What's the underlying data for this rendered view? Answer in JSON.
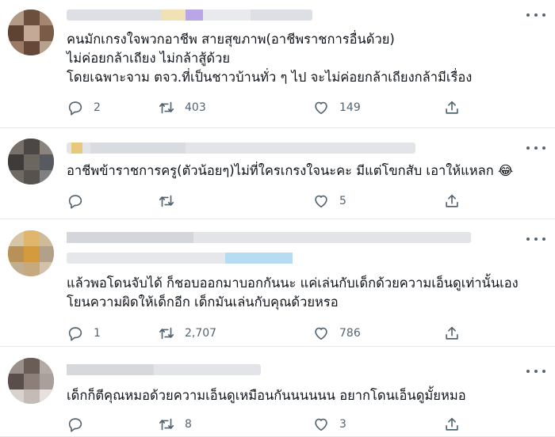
{
  "tweets": [
    {
      "lines": [
        "คนมักเกรงใจพวกอาชีพ สายสุขภาพ(อาชีพราชการอื่นด้วย)",
        "ไม่ค่อยกล้าเถียง ไม่กล้าสู้ด้วย",
        "โดยเฉพาะจาม ตจว.ที่เป็นชาวบ้านทั่ว ๆ ไป จะไม่ค่อยกล้าเถียงกล้ามีเรื่อง"
      ],
      "replies": "2",
      "retweets": "403",
      "likes": "149"
    },
    {
      "lines": [
        "อาชีพข้าราชการครู(ตัวน้อยๆ)ไม่ที่ใครเกรงใจนะคะ มีแต่โขกสับ เอาให้แหลก 😂"
      ],
      "replies": "",
      "retweets": "",
      "likes": "5"
    },
    {
      "lines": [
        "แล้วพอโดนจับได้ ก็ชอบออกมาบอกกันนะ แค่เล่นกับเด็กด้วยความเอ็นดูเท่านั้นเอง",
        "โยนความผิดให้เด็กอีก เด็กมันเล่นกับคุณด้วยหรอ"
      ],
      "replies": "1",
      "retweets": "2,707",
      "likes": "786"
    },
    {
      "lines": [
        "เด็กก็ตีคุณหมอด้วยความเอ็นดูเหมือนกันนนนนน อยากโดนเอ็นดูมั้ยหมอ"
      ],
      "replies": "",
      "retweets": "8",
      "likes": "3"
    }
  ],
  "icons": {
    "reply": "reply-icon",
    "retweet": "retweet-icon",
    "like": "heart-icon",
    "share": "share-icon",
    "more": "more-icon"
  },
  "colors": {
    "icon_gray": "#536471",
    "divider": "#e6e9eb",
    "text": "#0f1419"
  }
}
